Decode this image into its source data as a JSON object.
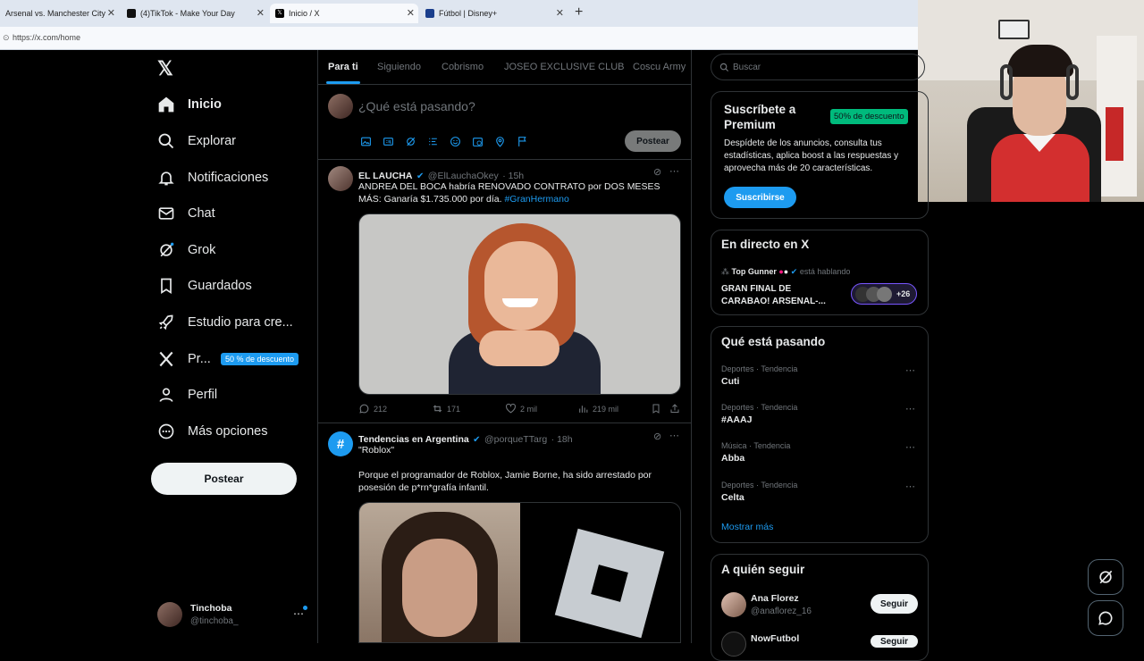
{
  "browser": {
    "tabs": [
      {
        "title": "Arsenal vs. Manchester City | F"
      },
      {
        "title": "(4)TikTok - Make Your Day"
      },
      {
        "title": "Inicio / X"
      },
      {
        "title": "Fútbol | Disney+"
      }
    ],
    "url": "https://x.com/home"
  },
  "nav": {
    "items": [
      {
        "label": "Inicio",
        "icon": "home-icon"
      },
      {
        "label": "Explorar",
        "icon": "search-icon"
      },
      {
        "label": "Notificaciones",
        "icon": "bell-icon"
      },
      {
        "label": "Chat",
        "icon": "mail-icon"
      },
      {
        "label": "Grok",
        "icon": "grok-icon"
      },
      {
        "label": "Guardados",
        "icon": "bookmark-icon"
      },
      {
        "label": "Estudio para cre...",
        "icon": "rocket-icon"
      },
      {
        "label": "Pr...",
        "icon": "x-logo-icon"
      },
      {
        "label": "Perfil",
        "icon": "person-icon"
      },
      {
        "label": "Más opciones",
        "icon": "more-circle-icon"
      }
    ],
    "premium_badge": "50 % de descuento",
    "post_button": "Postear",
    "profile": {
      "name": "Tinchoba",
      "handle": "@tinchoba_"
    }
  },
  "feed": {
    "tabs": [
      "Para ti",
      "Siguiendo",
      "Cobrismo",
      "JOSEO EXCLUSIVE CLUB",
      "Coscu Army"
    ],
    "composer_placeholder": "¿Qué está pasando?",
    "composer_button": "Postear",
    "tweets": [
      {
        "name": "EL LAUCHA",
        "handle": "@ElLauchaOkey",
        "time": "· 15h",
        "text": "ANDREA DEL BOCA habría RENOVADO CONTRATO por DOS MESES MÁS: Ganaría $1.735.000 por día.",
        "hashtag": "#GranHermano",
        "replies": "212",
        "retweets": "171",
        "likes": "2 mil",
        "views": "219 mil"
      },
      {
        "name": "Tendencias en Argentina",
        "handle": "@porqueTTarg",
        "time": "· 18h",
        "text_title": "\"Roblox\"",
        "text": "Porque el programador de Roblox, Jamie Borne, ha sido arrestado por posesión de p*rn*grafía infantil."
      }
    ]
  },
  "sidebar": {
    "search_placeholder": "Buscar",
    "premium": {
      "title": "Suscríbete a Premium",
      "badge": "50% de descuento",
      "body": "Despídete de los anuncios, consulta tus estadísticas, aplica boost a las respuestas y aprovecha más de 20 características.",
      "button": "Suscribirse"
    },
    "live": {
      "title": "En directo en X",
      "host": "Top Gunner",
      "status": "está hablando",
      "event": "GRAN FINAL DE CARABAO! ARSENAL-...",
      "listeners": "+26"
    },
    "trending": {
      "title": "Qué está pasando",
      "items": [
        {
          "category": "Deportes · Tendencia",
          "name": "Cuti"
        },
        {
          "category": "Deportes · Tendencia",
          "name": "#AAAJ"
        },
        {
          "category": "Música · Tendencia",
          "name": "Abba"
        },
        {
          "category": "Deportes · Tendencia",
          "name": "Celta"
        }
      ],
      "more": "Mostrar más"
    },
    "follow": {
      "title": "A quién seguir",
      "items": [
        {
          "name": "Ana Florez",
          "handle": "@anaflorez_16",
          "button": "Seguir"
        },
        {
          "name": "NowFutbol",
          "handle": "",
          "button": "Seguir"
        }
      ]
    }
  },
  "colors": {
    "accent": "#1d9bf0",
    "background": "#000000",
    "border": "#2f3336",
    "muted": "#71767b",
    "premium_badge": "#00ba7c"
  }
}
